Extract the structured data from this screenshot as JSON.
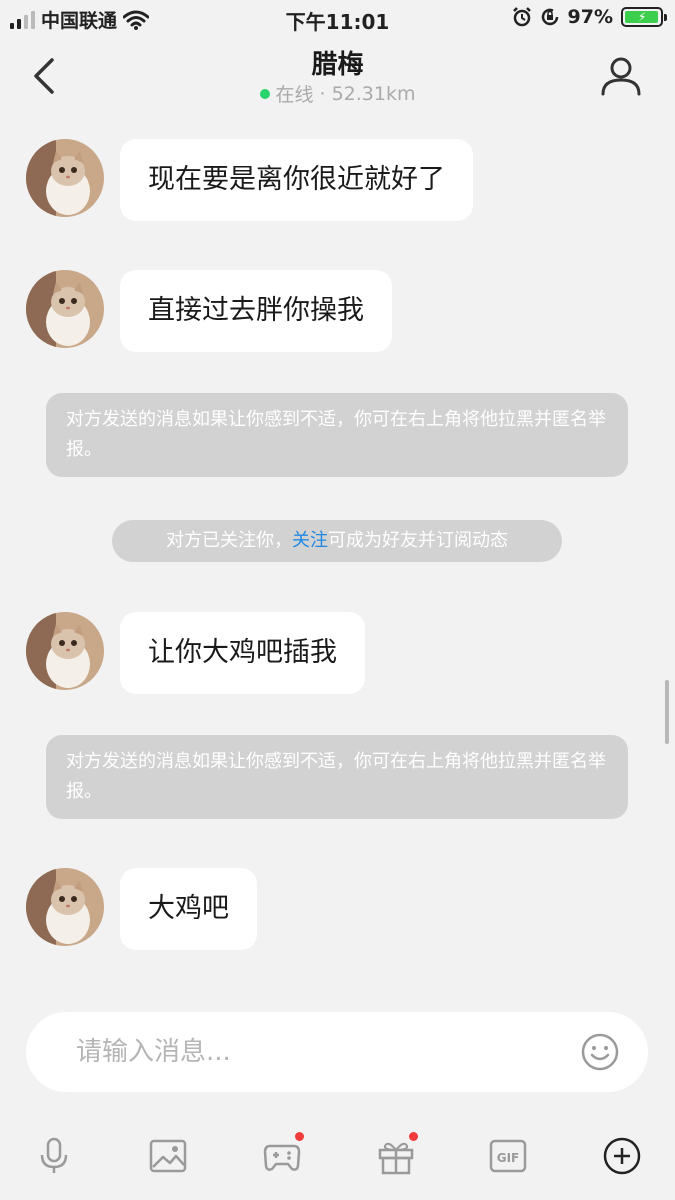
{
  "status_bar": {
    "carrier": "中国联通",
    "time": "下午11:01",
    "battery_percent": "97%",
    "battery_level": 0.97,
    "icons": [
      "signal-icon",
      "wifi-icon",
      "alarm-icon",
      "orientation-lock-icon",
      "battery-icon"
    ]
  },
  "header": {
    "title": "腊梅",
    "status": "在线",
    "separator": "·",
    "distance": "52.31km",
    "online_color": "#27d36b"
  },
  "messages": [
    {
      "type": "incoming",
      "text": "现在要是离你很近就好了"
    },
    {
      "type": "incoming",
      "text": "直接过去胖你操我"
    },
    {
      "type": "notice",
      "text": "对方发送的消息如果让你感到不适，你可在右上角将他拉黑并匿名举报。"
    },
    {
      "type": "follow",
      "before": "对方已关注你，",
      "link": "关注",
      "after": "可成为好友并订阅动态"
    },
    {
      "type": "incoming",
      "text": "让你大鸡吧插我"
    },
    {
      "type": "notice",
      "text": "对方发送的消息如果让你感到不适，你可在右上角将他拉黑并匿名举报。"
    },
    {
      "type": "incoming",
      "text": "大鸡吧"
    }
  ],
  "input": {
    "placeholder": "请输入消息..."
  },
  "toolbar": {
    "items": [
      "microphone-icon",
      "image-icon",
      "game-controller-icon",
      "gift-icon",
      "gif-icon",
      "plus-icon"
    ],
    "badges": [
      "game-controller-icon",
      "gift-icon"
    ]
  },
  "colors": {
    "link": "#1e88e5",
    "badge": "#f23b3b",
    "notice_bg": "#d2d2d2",
    "page_bg": "#f2f2f2"
  }
}
